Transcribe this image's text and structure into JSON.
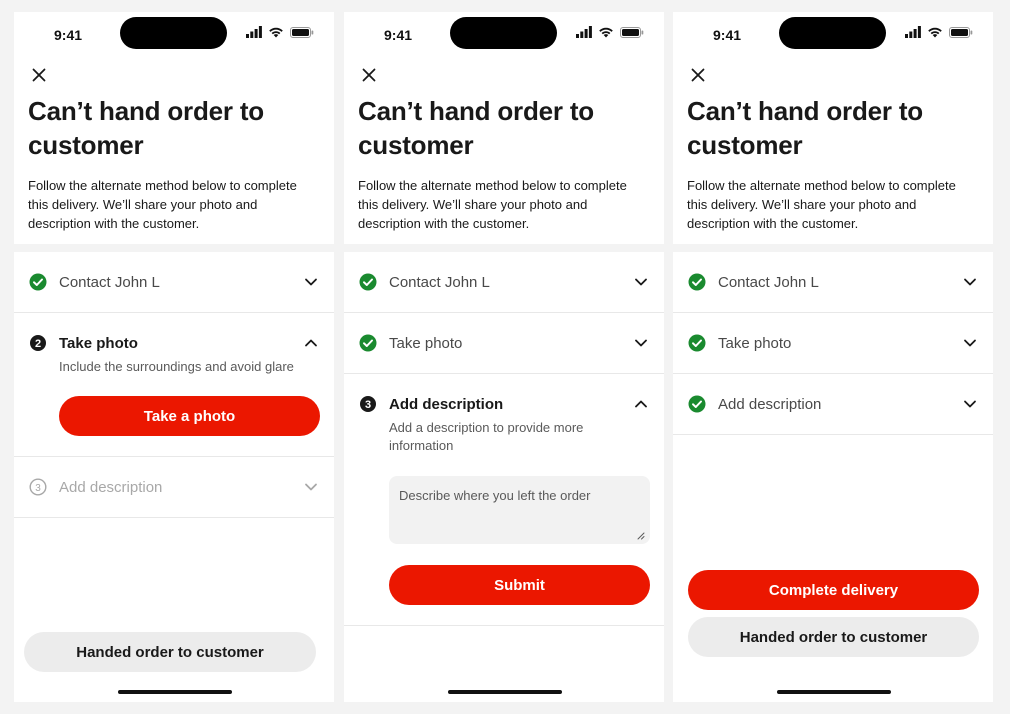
{
  "status": {
    "time": "9:41"
  },
  "header": {
    "title_line1": "Can’t hand order to",
    "title_line2": "customer",
    "subtitle_line1": "Follow the alternate method below to complete",
    "subtitle_line2": "this delivery. We’ll share your photo and",
    "subtitle_line3": "description with the customer."
  },
  "screens": [
    {
      "steps": [
        {
          "label": "Contact John L",
          "state": "done",
          "number": "1"
        },
        {
          "label": "Take photo",
          "state": "active",
          "number": "2",
          "description": "Include the surroundings and avoid glare"
        },
        {
          "label": "Add description",
          "state": "pending",
          "number": "3"
        }
      ],
      "primary_button": "Take a photo",
      "secondary_button": "Handed order to customer"
    },
    {
      "steps": [
        {
          "label": "Contact John L",
          "state": "done",
          "number": "1"
        },
        {
          "label": "Take photo",
          "state": "done",
          "number": "2"
        },
        {
          "label": "Add description",
          "state": "active",
          "number": "3",
          "description_line1": "Add a description to provide more",
          "description_line2": "information"
        }
      ],
      "textarea_placeholder": "Describe where you left the order",
      "primary_button": "Submit"
    },
    {
      "steps": [
        {
          "label": "Contact John L",
          "state": "done",
          "number": "1"
        },
        {
          "label": "Take photo",
          "state": "done",
          "number": "2"
        },
        {
          "label": "Add description",
          "state": "done",
          "number": "3"
        }
      ],
      "primary_button": "Complete delivery",
      "secondary_button": "Handed order to customer"
    }
  ],
  "colors": {
    "brand_red": "#eb1700",
    "success_green": "#1a8a2f",
    "text_primary": "#191919",
    "text_secondary": "#494949",
    "disabled": "#a8a8a8"
  },
  "icons": {
    "close": "close-icon",
    "done": "check-circle-icon",
    "chevron_down": "chevron-down-icon",
    "chevron_up": "chevron-up-icon"
  }
}
